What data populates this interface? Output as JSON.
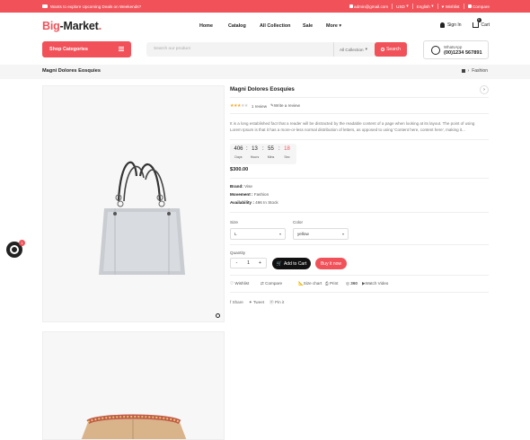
{
  "topbar": {
    "promo": "Wants to explore Upcoming Deals on Weekends?",
    "email": "admin@gmail.com",
    "currency": "USD",
    "language": "English",
    "wishlist": "Wishlist",
    "compare": "Compare"
  },
  "header": {
    "logo_part1": "Big",
    "logo_part2": "-Market",
    "logo_dot": ".",
    "nav": [
      "Home",
      "Catalog",
      "All Collection",
      "Sale",
      "More"
    ],
    "signin": "Sign In",
    "cart": "Cart",
    "cart_count": "0"
  },
  "searchbar": {
    "shop_categories": "Shop Categories",
    "placeholder": "Search our product",
    "collection": "All Collection",
    "search_btn": "Search",
    "whatsapp_label": "WhatsApp",
    "whatsapp_number": "(00)1234 567891"
  },
  "breadcrumb": {
    "title": "Magni Dolores Eosquies",
    "path": "Fashion"
  },
  "product": {
    "title": "Magni Dolores Eosquies",
    "rating": 3,
    "reviews": "1 review",
    "write_review": "Write a review",
    "description": "It is a long established fact that a reader will be distracted by the readable content of a page when looking at its layout. The point of using Lorem Ipsum is that it has a more-or-less normal distribution of letters, as opposed to using 'Content here, content here', making it...",
    "timer": {
      "days": "406",
      "hours": "13",
      "mins": "55",
      "secs": "18",
      "days_lbl": "Days",
      "hours_lbl": "Hours",
      "mins_lbl": "Mins",
      "secs_lbl": "Sec"
    },
    "price": "$300.00",
    "brand_label": "Brand:",
    "brand": "Vise",
    "movement_label": "Movement :",
    "movement": "Fashion",
    "availability_label": "Availability :",
    "availability": "496 In Stock",
    "size_label": "Size",
    "size_value": "L",
    "color_label": "Color",
    "color_value": "yellow",
    "qty_label": "Quantity",
    "qty_value": "1",
    "minus": "-",
    "plus": "+",
    "add_to_cart": "Add to Cart",
    "buy_now": "Buy it now",
    "actions": [
      "Wishlist",
      "Compare",
      "Size chart",
      "Print",
      "360",
      "Watch Video"
    ],
    "share": [
      "Share",
      "Tweet",
      "Pin it"
    ]
  },
  "floater_badge": "1"
}
